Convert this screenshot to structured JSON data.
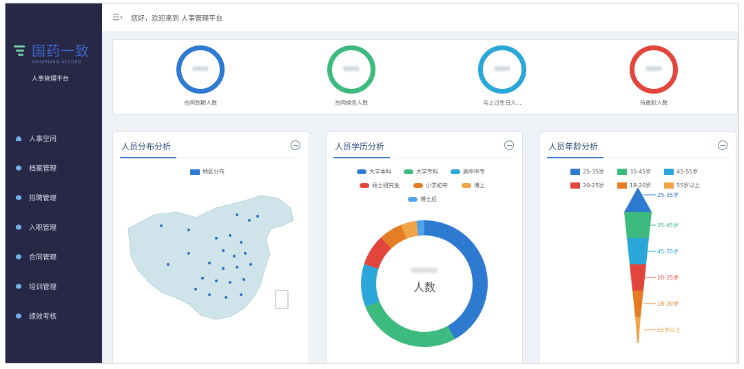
{
  "header": {
    "greeting": "您好，欢迎来到 人事管理平台"
  },
  "brand": {
    "name_cn": "国药一致",
    "name_en": "SINOPHARM ACCORD",
    "subtitle": "人事管理平台"
  },
  "sidebar": {
    "items": [
      {
        "label": "人事空间",
        "icon": "home-icon"
      },
      {
        "label": "档案管理",
        "icon": "cube-icon"
      },
      {
        "label": "招聘管理",
        "icon": "cube-icon"
      },
      {
        "label": "入职管理",
        "icon": "cube-icon"
      },
      {
        "label": "合同管理",
        "icon": "cube-icon"
      },
      {
        "label": "培训管理",
        "icon": "cube-icon"
      },
      {
        "label": "绩效考核",
        "icon": "cube-icon"
      }
    ]
  },
  "stats": [
    {
      "label": "合同到期人数",
      "value": "0000",
      "color": "#2f7ad1"
    },
    {
      "label": "合同续签人数",
      "value": "0000",
      "color": "#3dbb7f"
    },
    {
      "label": "马上过生日人...",
      "value": "0000",
      "color": "#2aa7d8"
    },
    {
      "label": "待离职人数",
      "value": "0000",
      "color": "#e2453c"
    }
  ],
  "panels": {
    "distribution": {
      "title": "人员分布分析",
      "legend": "地区分布",
      "legend_color": "#2f7ad1"
    },
    "education": {
      "title": "人员学历分析",
      "center_label": "人数",
      "center_value": "000000",
      "legend": [
        {
          "name": "大学本科",
          "color": "#2f7ad1"
        },
        {
          "name": "大学专科",
          "color": "#3dbb7f"
        },
        {
          "name": "高中中专",
          "color": "#2aa7d8"
        },
        {
          "name": "硕士研究生",
          "color": "#e2453c"
        },
        {
          "name": "小学初中",
          "color": "#e57d24"
        },
        {
          "name": "博上",
          "color": "#f0a347"
        },
        {
          "name": "博士后",
          "color": "#4da3e8"
        }
      ]
    },
    "age": {
      "title": "人员年龄分析",
      "legend": [
        {
          "name": "25-35岁",
          "color": "#2f7ad1"
        },
        {
          "name": "35-45岁",
          "color": "#3dbb7f"
        },
        {
          "name": "45-55岁",
          "color": "#2aa7d8"
        },
        {
          "name": "20-25岁",
          "color": "#e2453c"
        },
        {
          "name": "18-20岁",
          "color": "#e57d24"
        },
        {
          "name": "55岁以上",
          "color": "#f0a347"
        }
      ]
    }
  },
  "chart_data": [
    {
      "type": "pie",
      "title": "人员学历分析",
      "categories": [
        "大学本科",
        "大学专科",
        "高中中专",
        "硕士研究生",
        "小学初中",
        "博上",
        "博士后"
      ],
      "values": [
        42,
        27,
        11,
        8,
        6,
        4,
        2
      ]
    },
    {
      "type": "bar",
      "title": "人员年龄分析",
      "categories": [
        "25-35岁",
        "35-45岁",
        "45-55岁",
        "20-25岁",
        "18-20岁",
        "55岁以上"
      ],
      "values": [
        100,
        80,
        60,
        40,
        20,
        5
      ]
    }
  ]
}
